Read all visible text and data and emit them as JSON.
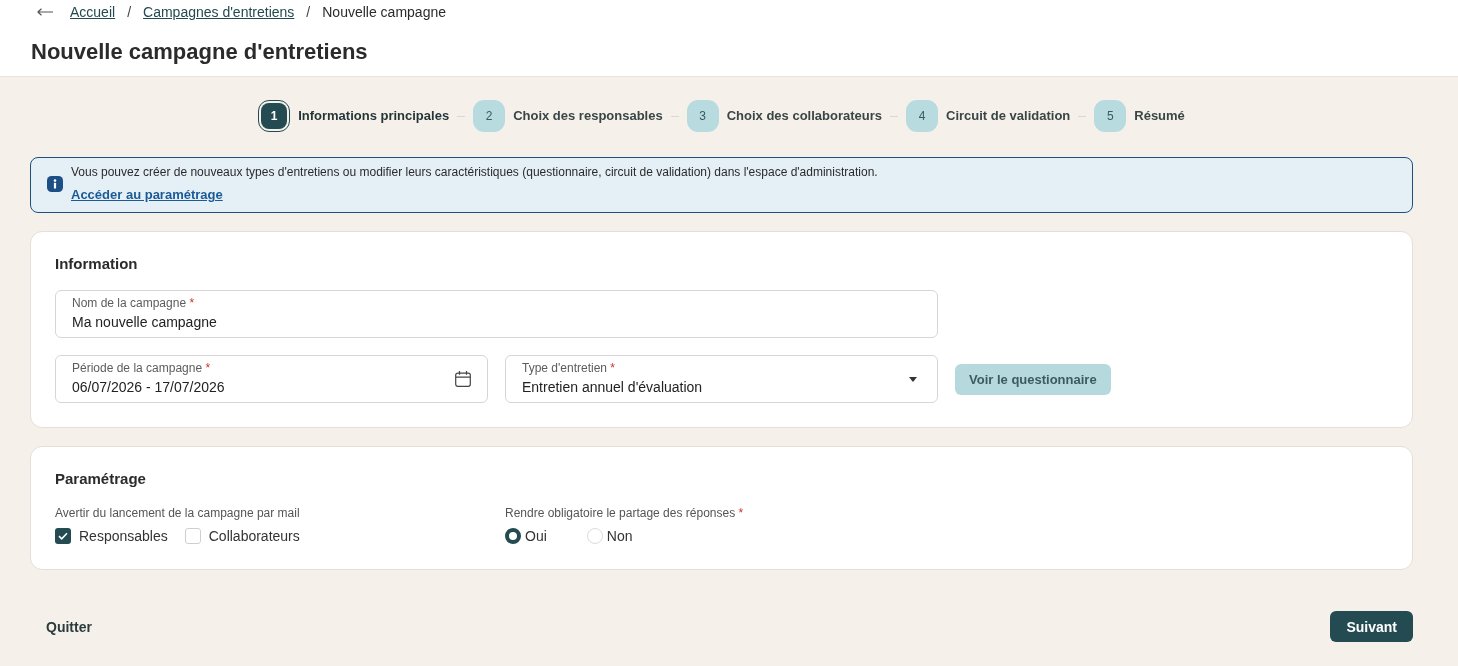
{
  "breadcrumb": [
    {
      "kind": "link",
      "label": "Accueil"
    },
    {
      "kind": "separator",
      "label": "/"
    },
    {
      "kind": "link",
      "label": "Campagnes d'entretiens"
    },
    {
      "kind": "separator",
      "label": "/"
    },
    {
      "kind": "current",
      "label": "Nouvelle campagne"
    }
  ],
  "page_title": "Nouvelle campagne d'entretiens",
  "steps": [
    {
      "number": "1",
      "label": "Informations principales",
      "selected": true
    },
    {
      "number": "2",
      "label": "Choix des responsables",
      "selected": false
    },
    {
      "number": "3",
      "label": "Choix des collaborateurs",
      "selected": false
    },
    {
      "number": "4",
      "label": "Circuit de validation",
      "selected": false
    },
    {
      "number": "5",
      "label": "Résumé",
      "selected": false
    }
  ],
  "info_banner": {
    "text": "Vous pouvez créer de nouveaux types d'entretiens ou modifier leurs caractéristiques (questionnaire, circuit de validation) dans l'espace d'administration.",
    "link": "Accéder au paramétrage"
  },
  "information": {
    "title": "Information",
    "fields": [
      {
        "kind": "text",
        "label": "Nom de la campagne",
        "required_mark": "*",
        "value": "Ma nouvelle campagne"
      },
      {
        "kind": "date",
        "label": "Période de la campagne",
        "required_mark": "*",
        "value": "06/07/2026 - 17/07/2026"
      },
      {
        "kind": "select",
        "label": "Type d'entretien",
        "required_mark": "*",
        "value": "Entretien annuel d'évaluation"
      }
    ],
    "button": "Voir le questionnaire"
  },
  "settings": {
    "title": "Paramétrage",
    "notify": {
      "label": "Avertir du lancement de la campagne par mail",
      "options": [
        {
          "label": "Responsables",
          "checked": true
        },
        {
          "label": "Collaborateurs",
          "checked": false
        }
      ]
    },
    "share": {
      "label": "Rendre obligatoire le partage des réponses",
      "required_mark": "*",
      "options": [
        {
          "label": "Oui",
          "selected": true
        },
        {
          "label": "Non",
          "selected": false
        }
      ]
    }
  },
  "footer": {
    "quit": "Quitter",
    "next": "Suivant"
  }
}
